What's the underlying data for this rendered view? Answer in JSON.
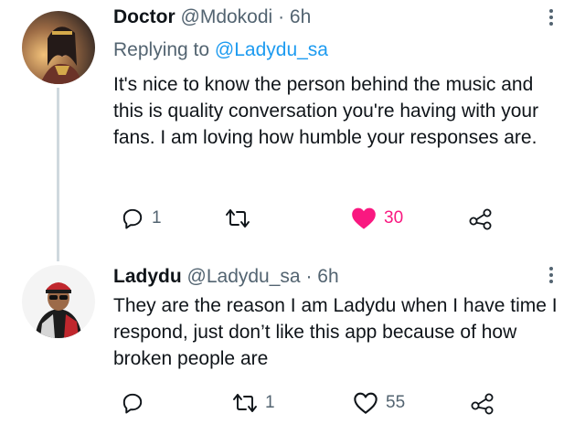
{
  "tweets": [
    {
      "name": "Doctor",
      "handle": "@Mdokodi",
      "separator": "·",
      "time": "6h",
      "replying_prefix": "Replying to",
      "replying_to": "@Ladydu_sa",
      "text": "It's nice to know the person behind the music and this is quality conversation you're having with your fans. I am loving how humble your responses are.",
      "replies": "1",
      "retweets": "",
      "likes": "30",
      "liked": true
    },
    {
      "name": "Ladydu",
      "handle": "@Ladydu_sa",
      "separator": "·",
      "time": "6h",
      "text": "They are the reason I am Ladydu when I have time I respond, just don’t like this app because of how broken people are",
      "replies": "",
      "retweets": "1",
      "likes": "55",
      "liked": false
    }
  ],
  "icons": {
    "reply": "reply-icon",
    "retweet": "retweet-icon",
    "like": "heart-icon",
    "share": "share-icon",
    "more": "more-icon"
  },
  "colors": {
    "text": "#0f1419",
    "secondary": "#536471",
    "link": "#1d9bf0",
    "like": "#f91880",
    "thread_line": "#cfd9de"
  }
}
